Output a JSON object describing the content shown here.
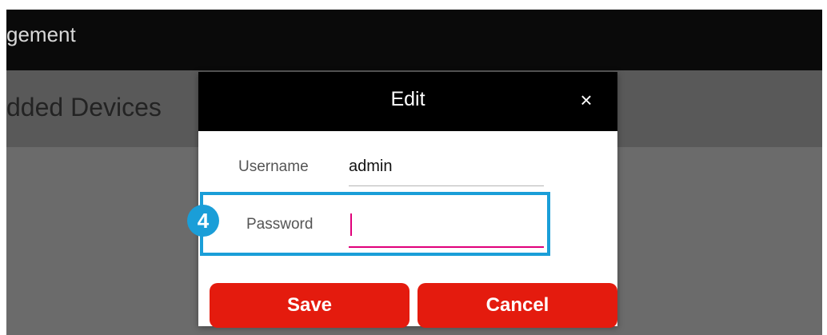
{
  "app_bar": {
    "title": "gement"
  },
  "subheader": {
    "title": "dded Devices"
  },
  "dialog": {
    "title": "Edit",
    "close_glyph": "×",
    "username": {
      "label": "Username",
      "value": "admin"
    },
    "password": {
      "label": "Password",
      "value": ""
    },
    "save_label": "Save",
    "cancel_label": "Cancel"
  },
  "annotation": {
    "step_number": "4",
    "color": "#1a9ed8"
  },
  "colors": {
    "primary_button": "#e41b0e",
    "focused_underline": "#e0007a",
    "header": "#000000"
  },
  "icons": {
    "close": "close-icon"
  }
}
